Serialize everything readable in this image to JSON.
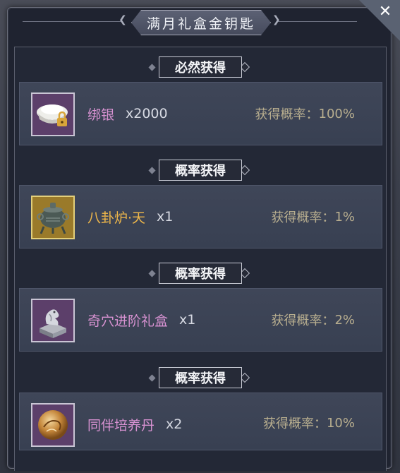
{
  "window": {
    "title": "满月礼盒金钥匙",
    "close_label": "✕"
  },
  "sections": [
    {
      "label": "必然获得",
      "item": {
        "name": "绑银",
        "quantity": "x2000",
        "rate_label": "获得概率：",
        "rate_value": "100%",
        "name_color": "#d892d2",
        "icon": "silver-ingot-icon"
      }
    },
    {
      "label": "概率获得",
      "item": {
        "name": "八卦炉·天",
        "quantity": "x1",
        "rate_label": "获得概率：",
        "rate_value": "1%",
        "name_color": "#f0b84a",
        "icon": "bagua-furnace-icon"
      }
    },
    {
      "label": "概率获得",
      "item": {
        "name": "奇穴进阶礼盒",
        "quantity": "x1",
        "rate_label": "获得概率：",
        "rate_value": "2%",
        "name_color": "#d892d2",
        "icon": "dragon-seal-box-icon"
      }
    },
    {
      "label": "概率获得",
      "item": {
        "name": "同伴培养丹",
        "quantity": "x2",
        "rate_label": "获得概率：",
        "rate_value": "10%",
        "name_color": "#d892d2",
        "icon": "golden-pill-icon"
      }
    }
  ],
  "colors": {
    "purple_frame": "#5c3f6a",
    "gold_frame": "#9a7a2a",
    "rate_text": "#b8ae8f"
  }
}
